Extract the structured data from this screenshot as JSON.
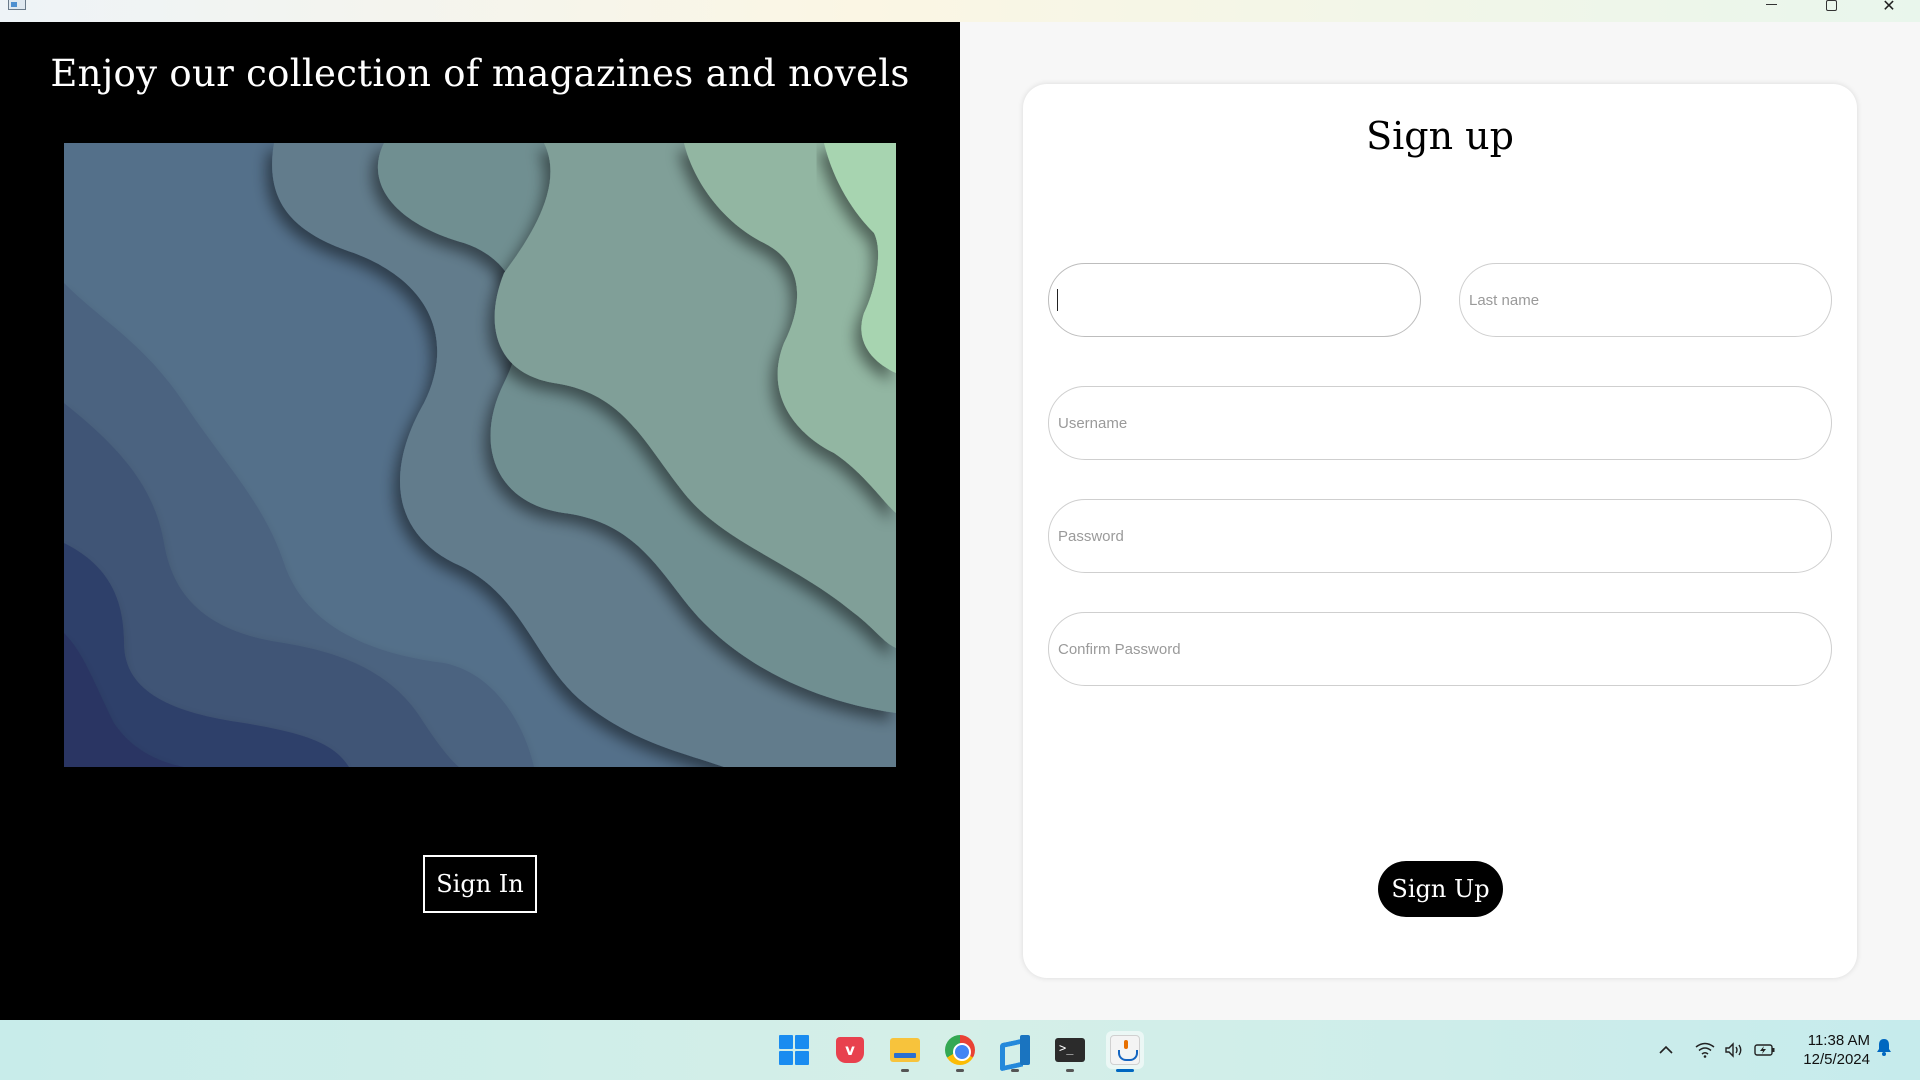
{
  "window": {
    "minimize_label": "—",
    "maximize_label": "",
    "close_label": "✕"
  },
  "left_panel": {
    "title": "Enjoy our collection of magazines and novels",
    "sign_in_label": "Sign In"
  },
  "signup_form": {
    "title": "Sign up",
    "first_name": {
      "value": "",
      "placeholder": ""
    },
    "last_name": {
      "value": "",
      "placeholder": "Last name"
    },
    "username": {
      "value": "",
      "placeholder": "Username"
    },
    "password": {
      "value": "",
      "placeholder": "Password"
    },
    "confirm_password": {
      "value": "",
      "placeholder": "Confirm Password"
    },
    "submit_label": "Sign Up"
  },
  "taskbar": {
    "apps": [
      {
        "name": "start-icon",
        "active": false
      },
      {
        "name": "pocket-icon",
        "active": false
      },
      {
        "name": "file-explorer-icon",
        "active": false
      },
      {
        "name": "chrome-icon",
        "active": false
      },
      {
        "name": "vscode-icon",
        "active": false
      },
      {
        "name": "terminal-icon",
        "active": false
      },
      {
        "name": "java-app-icon",
        "active": true
      }
    ],
    "terminal_glyph": ">_",
    "tray_chevron": "^",
    "clock_time": "11:38 AM",
    "clock_date": "12/5/2024",
    "accent_color": "#0067c0"
  }
}
